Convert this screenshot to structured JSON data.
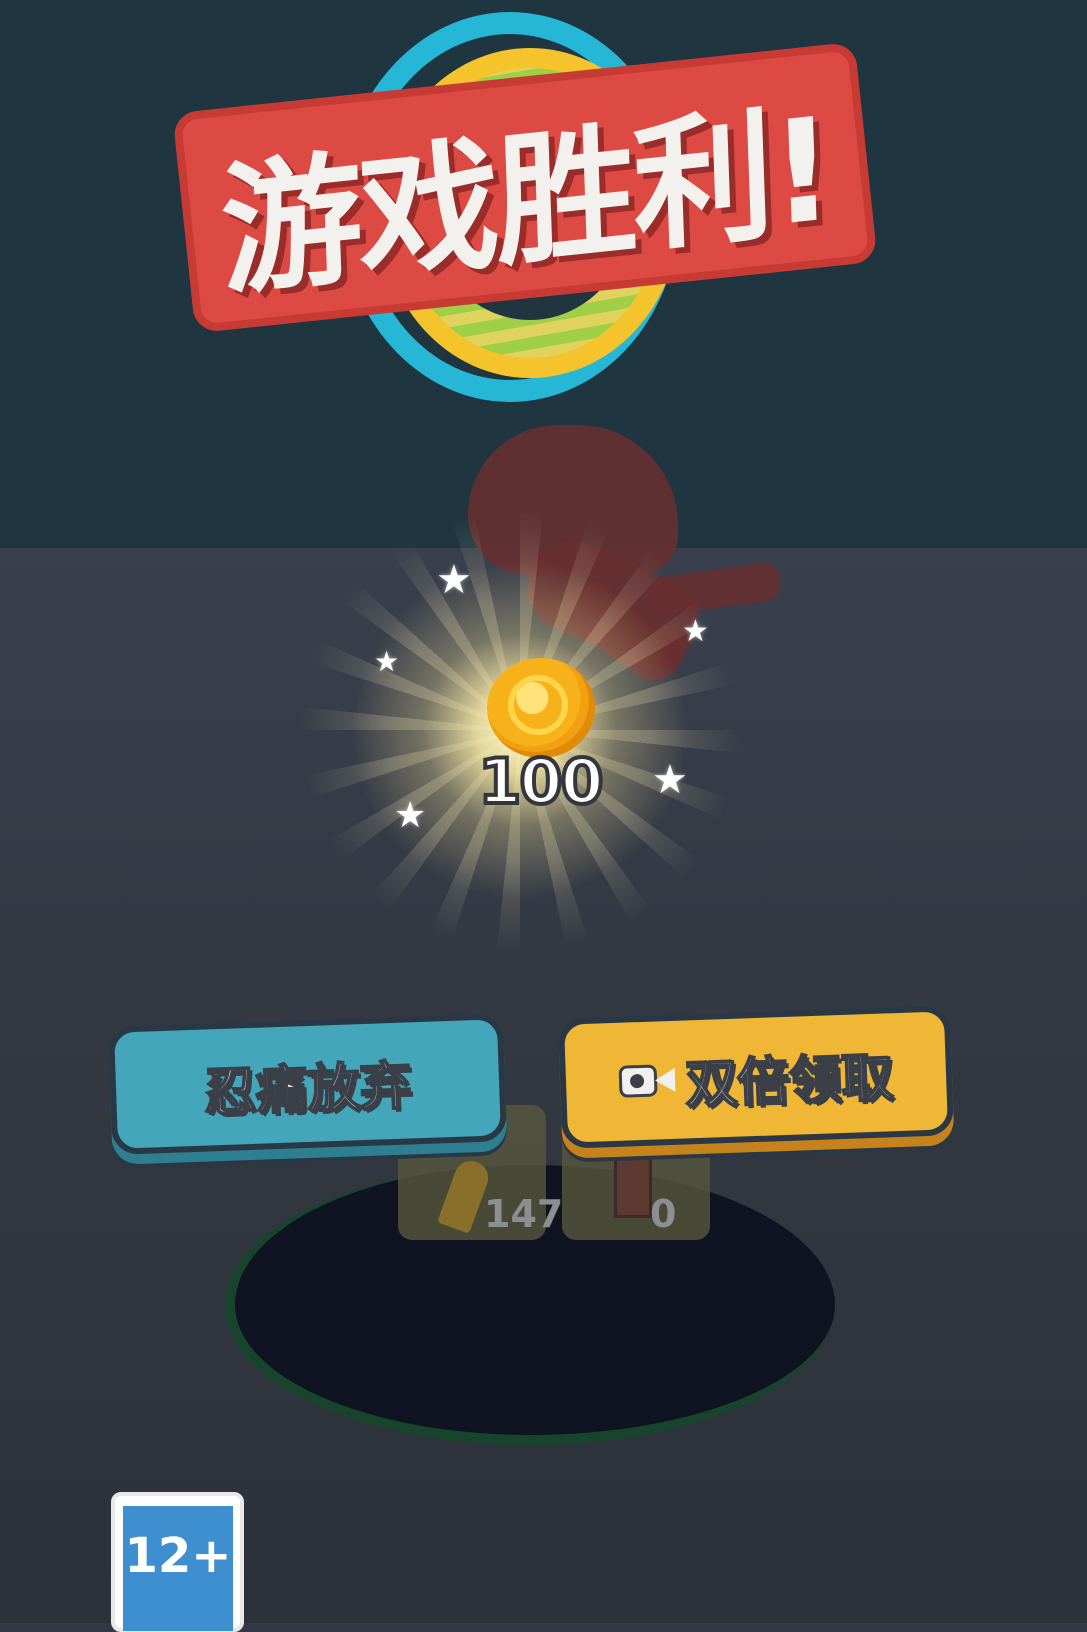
{
  "title": {
    "text": "游戏胜利!"
  },
  "reward": {
    "amount": "100",
    "icon": "gold-coin-icon"
  },
  "items": [
    {
      "icon": "bullet-icon",
      "count": "147"
    },
    {
      "icon": "tube-icon",
      "count": "0"
    }
  ],
  "buttons": {
    "give_up": "忍痛放弃",
    "double_claim": "双倍领取",
    "double_claim_icon": "video-icon"
  },
  "age_rating": "12+",
  "colors": {
    "sky": "#1f3641",
    "floor": "#333844",
    "title_banner": "#dd4a44",
    "give_up_button": "#44a6bb",
    "double_button": "#f0b736",
    "coin": "#f7b21b",
    "age_badge": "#3d8fcf"
  }
}
